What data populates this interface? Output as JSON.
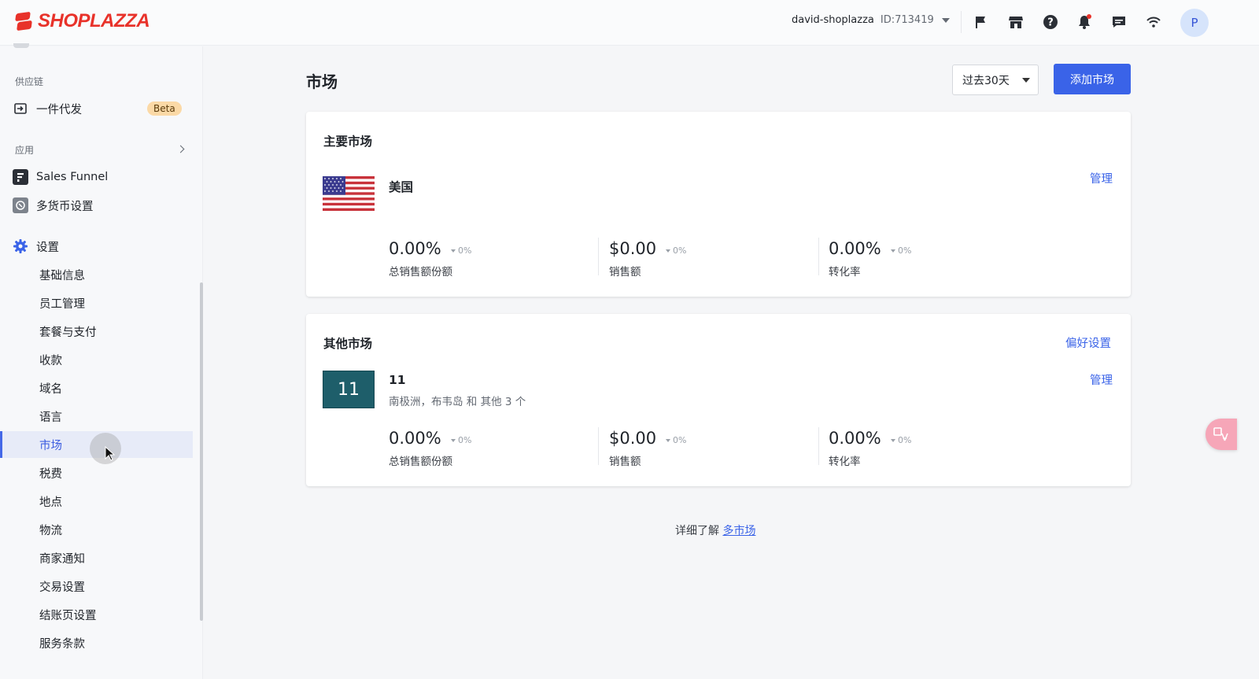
{
  "header": {
    "brand": "SHOPLAZZA",
    "account_name": "david-shoplazza",
    "account_id": "ID:713419",
    "avatar_initial": "P",
    "icons": [
      "flag-icon",
      "store-icon",
      "help-icon",
      "bell-icon",
      "chat-icon",
      "wifi-icon"
    ],
    "brand_color": "#e8322a"
  },
  "sidebar": {
    "section_supply": "供应链",
    "dropship_label": "一件代发",
    "beta_label": "Beta",
    "section_apps": "应用",
    "apps": [
      {
        "label": "Sales Funnel",
        "icon": "funnel-app-icon"
      },
      {
        "label": "多货币设置",
        "icon": "currency-app-icon"
      }
    ],
    "settings_label": "设置",
    "settings_items": [
      "基础信息",
      "员工管理",
      "套餐与支付",
      "收款",
      "域名",
      "语言",
      "市场",
      "税费",
      "地点",
      "物流",
      "商家通知",
      "交易设置",
      "结账页设置",
      "服务条款"
    ],
    "active_item": "市场"
  },
  "main": {
    "title": "市场",
    "range_select": "过去30天",
    "add_button": "添加市场",
    "primary": {
      "title": "主要市场",
      "market_name": "美国",
      "manage": "管理",
      "metrics": [
        {
          "value": "0.00%",
          "delta": "0%",
          "label": "总销售额份额"
        },
        {
          "value": "$0.00",
          "delta": "0%",
          "label": "销售额"
        },
        {
          "value": "0.00%",
          "delta": "0%",
          "label": "转化率"
        }
      ]
    },
    "other": {
      "title": "其他市场",
      "preferences": "偏好设置",
      "thumb": "11",
      "market_name": "11",
      "market_regions": "南极洲，布韦岛 和 其他 3 个",
      "manage": "管理",
      "metrics": [
        {
          "value": "0.00%",
          "delta": "0%",
          "label": "总销售额份额"
        },
        {
          "value": "$0.00",
          "delta": "0%",
          "label": "销售额"
        },
        {
          "value": "0.00%",
          "delta": "0%",
          "label": "转化率"
        }
      ]
    },
    "learn_more_prefix": "详细了解",
    "learn_more_link": "多市场",
    "accent_color": "#3a63e8"
  }
}
